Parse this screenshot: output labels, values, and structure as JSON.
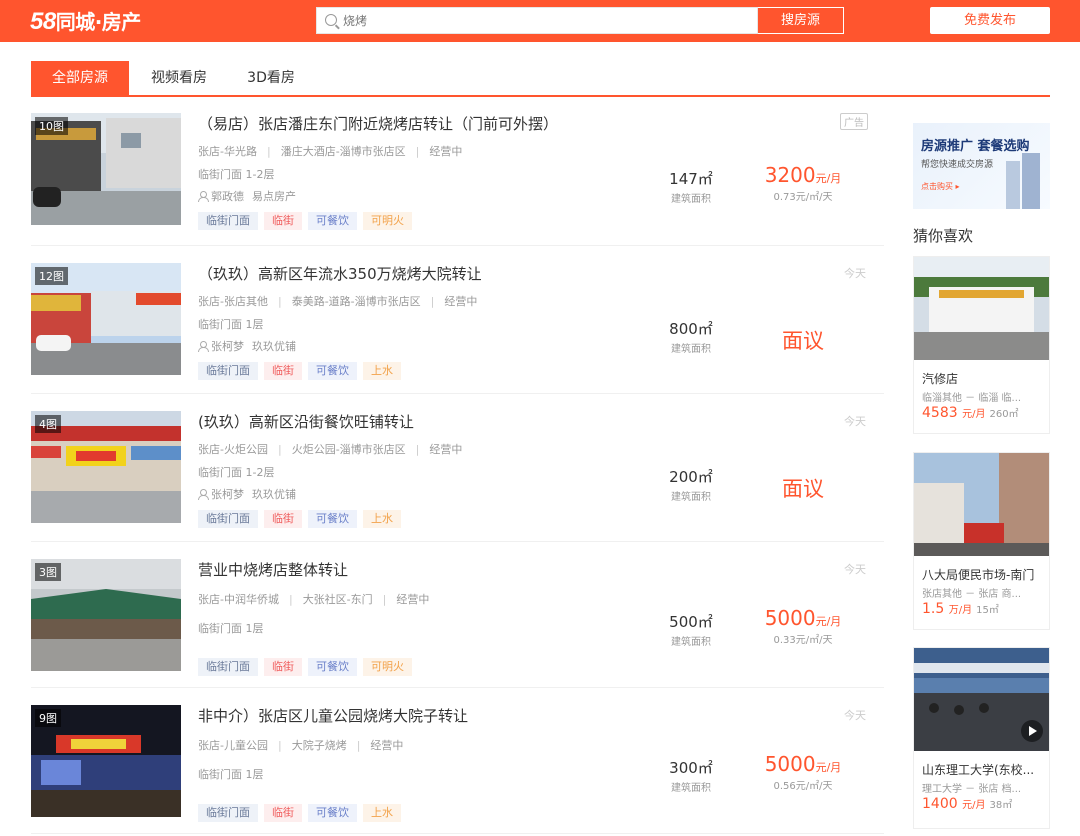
{
  "header": {
    "logo_num": "58",
    "logo_text": "同城·房产",
    "search_placeholder": "烧烤",
    "search_button": "搜房源",
    "publish_button": "免费发布"
  },
  "tabs": [
    {
      "label": "全部房源",
      "active": true
    },
    {
      "label": "视频看房",
      "active": false
    },
    {
      "label": "3D看房",
      "active": false
    }
  ],
  "listings": [
    {
      "photo_count": "10图",
      "title": "（易店）张店潘庄东门附近烧烤店转让（门前可外摆）",
      "district": "张店-华光路",
      "address": "潘庄大酒店-淄博市张店区",
      "status": "经营中",
      "type": "临街门面 1-2层",
      "agent": "郭政德",
      "company": "易点房产",
      "tags": [
        "临街门面",
        "临街",
        "可餐饮",
        "可明火"
      ],
      "area": "147㎡",
      "area_label": "建筑面积",
      "price": "3200",
      "price_unit": "元/月",
      "unit_price": "0.73元/㎡/天",
      "date": "",
      "ad": "广告"
    },
    {
      "photo_count": "12图",
      "title": "（玖玖）高新区年流水350万烧烤大院转让",
      "district": "张店-张店其他",
      "address": "泰美路-道路-淄博市张店区",
      "status": "经营中",
      "type": "临街门面 1层",
      "agent": "张柯梦",
      "company": "玖玖优铺",
      "tags": [
        "临街门面",
        "临街",
        "可餐饮",
        "上水"
      ],
      "area": "800㎡",
      "area_label": "建筑面积",
      "price": "面议",
      "price_unit": "",
      "unit_price": "",
      "date": "今天",
      "ad": ""
    },
    {
      "photo_count": "4图",
      "title": "(玖玖）高新区沿街餐饮旺铺转让",
      "district": "张店-火炬公园",
      "address": "火炬公园-淄博市张店区",
      "status": "经营中",
      "type": "临街门面 1-2层",
      "agent": "张柯梦",
      "company": "玖玖优铺",
      "tags": [
        "临街门面",
        "临街",
        "可餐饮",
        "上水"
      ],
      "area": "200㎡",
      "area_label": "建筑面积",
      "price": "面议",
      "price_unit": "",
      "unit_price": "",
      "date": "今天",
      "ad": ""
    },
    {
      "photo_count": "3图",
      "title": "营业中烧烤店整体转让",
      "district": "张店-中润华侨城",
      "address": "大张社区-东门",
      "status": "经营中",
      "type": "临街门面 1层",
      "agent": "",
      "company": "",
      "tags": [
        "临街门面",
        "临街",
        "可餐饮",
        "可明火"
      ],
      "area": "500㎡",
      "area_label": "建筑面积",
      "price": "5000",
      "price_unit": "元/月",
      "unit_price": "0.33元/㎡/天",
      "date": "今天",
      "ad": ""
    },
    {
      "photo_count": "9图",
      "title": "非中介）张店区儿童公园烧烤大院子转让",
      "district": "张店-儿童公园",
      "address": "大院子烧烤",
      "status": "经营中",
      "type": "临街门面 1层",
      "agent": "",
      "company": "",
      "tags": [
        "临街门面",
        "临街",
        "可餐饮",
        "上水"
      ],
      "area": "300㎡",
      "area_label": "建筑面积",
      "price": "5000",
      "price_unit": "元/月",
      "unit_price": "0.56元/㎡/天",
      "date": "今天",
      "ad": ""
    }
  ],
  "sidebar": {
    "ad": {
      "line1": "房源推广 套餐选购",
      "line2": "帮您快速成交房源",
      "line3": "点击购买 ▸"
    },
    "guess_title": "猜你喜欢",
    "cards": [
      {
        "name": "汽修店",
        "loc": "临淄其他 － 临淄 临...",
        "price": "4583",
        "price_unit": "元/月",
        "area": "260㎡"
      },
      {
        "name": "八大局便民市场-南门",
        "loc": "张店其他 － 张店 商...",
        "price": "1.5",
        "price_unit": "万/月",
        "area": "15㎡"
      },
      {
        "name": "山东理工大学(东校...",
        "loc": "理工大学 － 张店 档...",
        "price": "1400",
        "price_unit": "元/月",
        "area": "38㎡"
      }
    ]
  },
  "colors": {
    "accent": "#ff552e"
  }
}
